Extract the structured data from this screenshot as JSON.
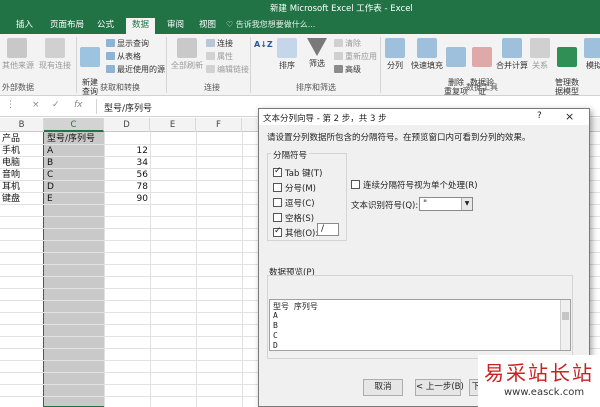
{
  "window": {
    "title": "新建 Microsoft Excel 工作表 - Excel"
  },
  "tabs": [
    "插入",
    "页面布局",
    "公式",
    "数据",
    "审阅",
    "视图"
  ],
  "active_tab": "数据",
  "tell_me": "告诉我您想要做什么...",
  "ribbon": {
    "other_sources": "其他来源",
    "existing_conn": "现有连接",
    "new_query": "新建\n查询",
    "show_query": "显示查询",
    "from_table": "从表格",
    "recent_sources": "最近使用的源",
    "refresh_all": "全部刷新",
    "connections": "连接",
    "properties": "属性",
    "edit_links": "编辑链接",
    "sort_az": "A↓Z",
    "sort": "排序",
    "filter": "筛选",
    "clear": "清除",
    "reapply": "重新应用",
    "advanced": "高级",
    "text_to_columns": "分列",
    "flash_fill": "快速填充",
    "remove_dup": "删除\n重复项",
    "data_validation": "数据验\n证",
    "consolidate": "合并计算",
    "relationships": "关系",
    "manage_model": "管理数\n据模型",
    "whatif": "模拟",
    "groups": {
      "external": "外部数据",
      "get_transform": "获取和转换",
      "connections": "连接",
      "sort_filter": "排序和筛选",
      "data_tools": "数据工具"
    }
  },
  "formula_bar": {
    "cancel": "×",
    "enter": "✓",
    "fx": "fx",
    "value": "型号/序列号"
  },
  "columns": [
    "B",
    "C",
    "D",
    "E",
    "F"
  ],
  "cells": {
    "b_header": "产品",
    "c_header": "型号/序列号",
    "rows": [
      {
        "b": "手机",
        "c": "A",
        "d": "12"
      },
      {
        "b": "电脑",
        "c": "B",
        "d": "34"
      },
      {
        "b": "音响",
        "c": "C",
        "d": "56"
      },
      {
        "b": "耳机",
        "c": "D",
        "d": "78"
      },
      {
        "b": "键盘",
        "c": "E",
        "d": "90"
      }
    ]
  },
  "dialog": {
    "title": "文本分列向导 - 第 2 步，共 3 步",
    "help": "?",
    "close": "×",
    "instructions": "请设置分列数据所包含的分隔符号。在预览窗口内可看到分列的效果。",
    "delimiters_label": "分隔符号",
    "tab": "Tab 键(T)",
    "semicolon": "分号(M)",
    "comma": "逗号(C)",
    "space": "空格(S)",
    "other": "其他(O):",
    "other_value": "/",
    "consecutive": "连续分隔符号视为单个处理(R)",
    "qualifier_label": "文本识别符号(Q):",
    "qualifier_value": "\"",
    "preview_label": "数据预览(P)",
    "preview_rows": [
      "型号 序列号",
      "A",
      "B",
      "C",
      "D"
    ],
    "cancel": "取消",
    "back": "< 上一步(B)",
    "next": "下"
  },
  "watermark": {
    "cn": "易采站长站",
    "url": "www.easck.com"
  },
  "colors": {
    "excel_green": "#217346",
    "watermark_red": "#cc1f1f"
  }
}
